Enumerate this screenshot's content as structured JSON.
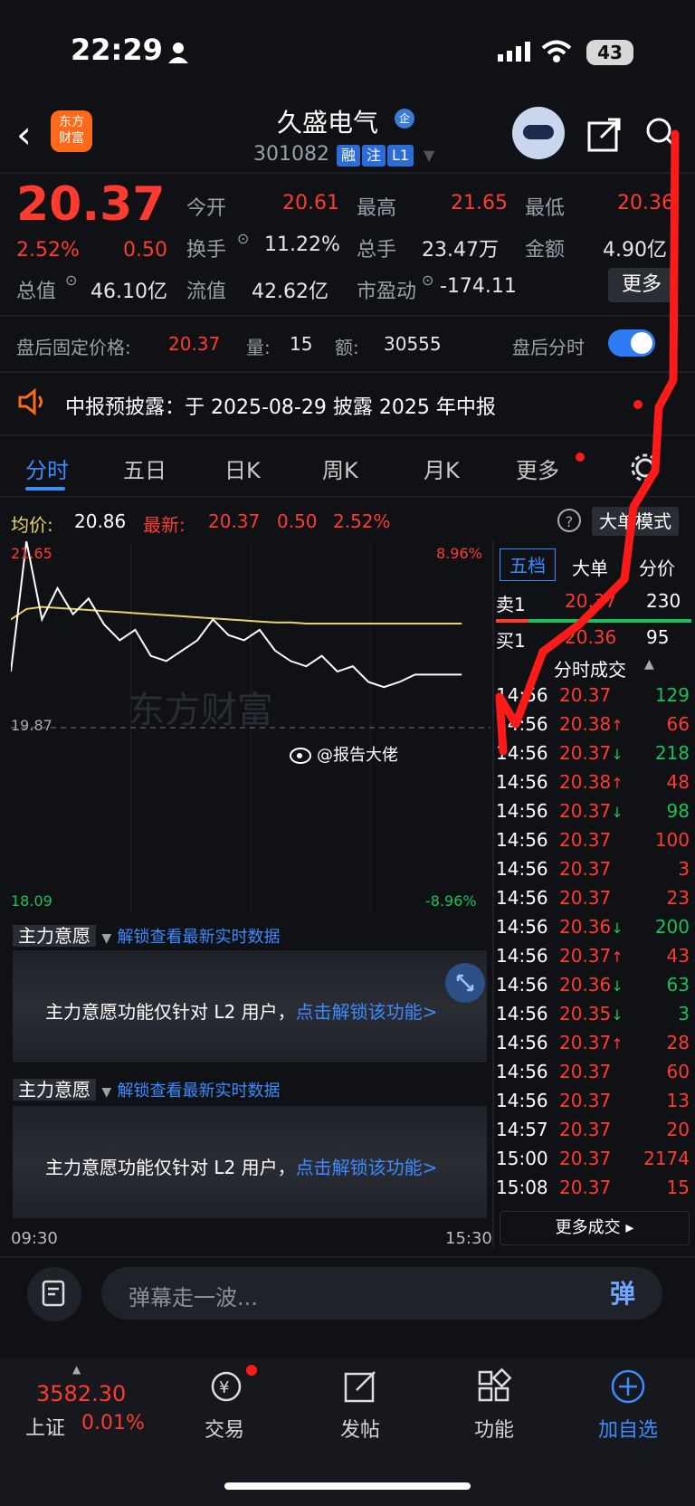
{
  "status_bar": {
    "time": "22:29",
    "battery": "43"
  },
  "header": {
    "app_logo": "东方\n财富",
    "stock_name": "久盛电气",
    "name_badge": "企",
    "stock_code": "301082",
    "tags": [
      "融",
      "注",
      "L1"
    ]
  },
  "quote": {
    "price": "20.37",
    "change_pct": "2.52%",
    "change": "0.50",
    "labels": {
      "open": "今开",
      "high": "最高",
      "low": "最低",
      "turnover": "换手",
      "volume": "总手",
      "amount": "金额",
      "total_mv": "总值",
      "float_mv": "流值",
      "pe": "市盈动"
    },
    "values": {
      "open": "20.61",
      "high": "21.65",
      "low": "20.36",
      "turnover": "11.22%",
      "volume": "23.47万",
      "amount": "4.90亿",
      "total_mv": "46.10亿",
      "float_mv": "42.62亿",
      "pe": "-174.11"
    },
    "more_label": "更多"
  },
  "after_hours": {
    "label": "盘后固定价格:",
    "price": "20.37",
    "vol_label": "量:",
    "vol": "15",
    "amt_label": "额:",
    "amt": "30555",
    "toggle_label": "盘后分时"
  },
  "notice": {
    "text": "中报预披露：于 2025-08-29 披露 2025 年中报"
  },
  "tabs": [
    "分时",
    "五日",
    "日K",
    "周K",
    "月K",
    "更多"
  ],
  "chart_header": {
    "avg_label": "均价:",
    "avg": "20.86",
    "last_label": "最新:",
    "last": "20.37",
    "chg": "0.50",
    "pct": "2.52%",
    "help": "?",
    "mode_label": "大单模式"
  },
  "chart_axes": {
    "y_top": "21.65",
    "y_mid": "19.87",
    "y_bottom": "18.09",
    "pct_top": "8.96%",
    "pct_bottom": "-8.96%",
    "x_start": "09:30",
    "x_end": "15:30",
    "watermark": "东方财富",
    "weibo": "@报告大佬"
  },
  "chart_data": {
    "type": "line",
    "title": "",
    "x": [
      "09:30",
      "15:30"
    ],
    "ylim": [
      18.09,
      21.65
    ],
    "series": [
      {
        "name": "",
        "color": "#ffffff",
        "values": [
          20.4,
          21.65,
          20.9,
          21.2,
          20.95,
          21.1,
          20.85,
          20.7,
          20.8,
          20.55,
          20.5,
          20.6,
          20.7,
          20.9,
          20.75,
          20.7,
          20.8,
          20.6,
          20.5,
          20.45,
          20.55,
          20.4,
          20.45,
          20.3,
          20.25,
          20.3,
          20.37,
          20.37,
          20.37,
          20.37
        ]
      },
      {
        "name": "均价",
        "color": "#e8d36a",
        "values": [
          20.9,
          21.0,
          21.02,
          21.01,
          21.0,
          20.99,
          20.98,
          20.97,
          20.96,
          20.95,
          20.94,
          20.93,
          20.92,
          20.91,
          20.9,
          20.89,
          20.88,
          20.87,
          20.87,
          20.86,
          20.86,
          20.86,
          20.86,
          20.86,
          20.86,
          20.86,
          20.86,
          20.86,
          20.86,
          20.86
        ]
      }
    ]
  },
  "main_force": {
    "label": "主力意愿",
    "unlock_link": "解锁查看最新实时数据",
    "lock_text": "主力意愿功能仅针对 L2 用户，",
    "lock_link": "点击解锁该功能>"
  },
  "right_panel": {
    "tabs": [
      "五档",
      "大单",
      "分价"
    ],
    "sell1": {
      "label": "卖1",
      "price": "20.37",
      "vol": "230"
    },
    "buy1": {
      "label": "买1",
      "price": "20.36",
      "vol": "95"
    },
    "ticks_header": "分时成交",
    "ticks": [
      {
        "time": "14:56",
        "price": "20.37",
        "dir": "",
        "vol": "129",
        "vol_color": "green"
      },
      {
        "time": "14:56",
        "price": "20.38",
        "dir": "↑",
        "vol": "66",
        "vol_color": "red"
      },
      {
        "time": "14:56",
        "price": "20.37",
        "dir": "↓",
        "vol": "218",
        "vol_color": "green"
      },
      {
        "time": "14:56",
        "price": "20.38",
        "dir": "↑",
        "vol": "48",
        "vol_color": "red"
      },
      {
        "time": "14:56",
        "price": "20.37",
        "dir": "↓",
        "vol": "98",
        "vol_color": "green"
      },
      {
        "time": "14:56",
        "price": "20.37",
        "dir": "",
        "vol": "100",
        "vol_color": "red"
      },
      {
        "time": "14:56",
        "price": "20.37",
        "dir": "",
        "vol": "3",
        "vol_color": "red"
      },
      {
        "time": "14:56",
        "price": "20.37",
        "dir": "",
        "vol": "23",
        "vol_color": "red"
      },
      {
        "time": "14:56",
        "price": "20.36",
        "dir": "↓",
        "vol": "200",
        "vol_color": "green"
      },
      {
        "time": "14:56",
        "price": "20.37",
        "dir": "↑",
        "vol": "43",
        "vol_color": "red"
      },
      {
        "time": "14:56",
        "price": "20.36",
        "dir": "↓",
        "vol": "63",
        "vol_color": "green"
      },
      {
        "time": "14:56",
        "price": "20.35",
        "dir": "↓",
        "vol": "3",
        "vol_color": "green"
      },
      {
        "time": "14:56",
        "price": "20.37",
        "dir": "↑",
        "vol": "28",
        "vol_color": "red"
      },
      {
        "time": "14:56",
        "price": "20.37",
        "dir": "",
        "vol": "60",
        "vol_color": "red"
      },
      {
        "time": "14:56",
        "price": "20.37",
        "dir": "",
        "vol": "13",
        "vol_color": "red"
      },
      {
        "time": "14:57",
        "price": "20.37",
        "dir": "",
        "vol": "20",
        "vol_color": "red"
      },
      {
        "time": "15:00",
        "price": "20.37",
        "dir": "",
        "vol": "2174",
        "vol_color": "red"
      },
      {
        "time": "15:08",
        "price": "20.37",
        "dir": "",
        "vol": "15",
        "vol_color": "red"
      }
    ],
    "more_ticks": "更多成交 ▸"
  },
  "comment": {
    "placeholder": "弹幕走一波...",
    "danmu": "弹"
  },
  "bottom_nav": {
    "index_value": "3582.30",
    "index_name": "上证",
    "index_pct": "0.01%",
    "trade": "交易",
    "post": "发帖",
    "func": "功能",
    "add": "加自选"
  },
  "colors": {
    "up": "#ff3b30",
    "down": "#19c15a",
    "accent": "#3d8bff",
    "annotation": "#ff1a1a"
  }
}
